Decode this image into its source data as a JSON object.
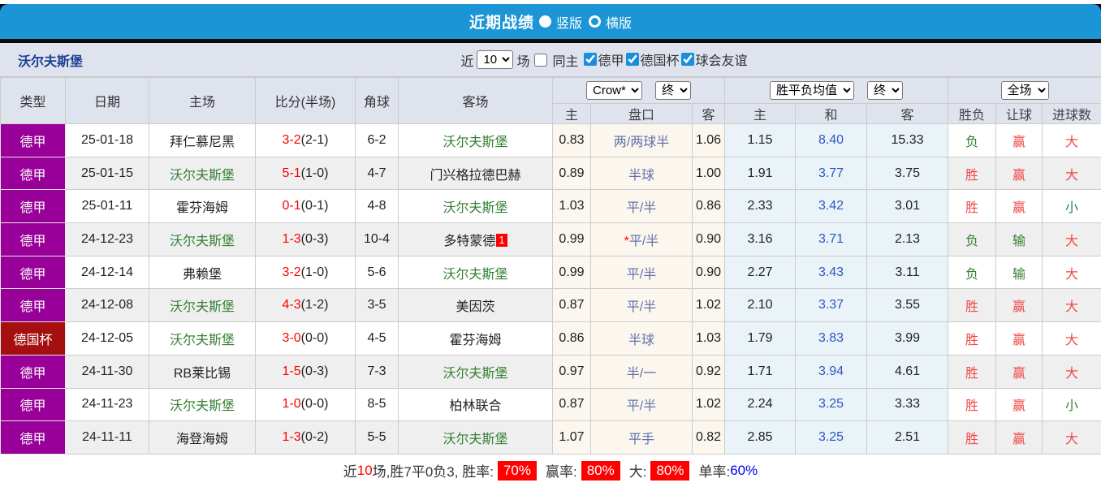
{
  "topbar": {
    "title": "近期战绩",
    "radio_vertical": "竖版",
    "radio_horizontal": "横版"
  },
  "filter": {
    "team": "沃尔夫斯堡",
    "near_label": "近",
    "count": "10",
    "unit_label": "场",
    "same_home_label": "同主",
    "comps": [
      {
        "label": "德甲",
        "checked": true
      },
      {
        "label": "德国杯",
        "checked": true
      },
      {
        "label": "球会友谊",
        "checked": true
      }
    ]
  },
  "table": {
    "main_headers": [
      "类型",
      "日期",
      "主场",
      "比分(半场)",
      "角球",
      "客场"
    ],
    "selects": {
      "bookmaker": "Crow*",
      "bookmaker_time": "终",
      "avg": "胜平负均值",
      "avg_time": "终",
      "scope": "全场"
    },
    "sub_headers": [
      "主",
      "盘口",
      "客",
      "主",
      "和",
      "客",
      "胜负",
      "让球",
      "进球数"
    ],
    "rows": [
      {
        "type": "德甲",
        "type_style": "league",
        "date": "25-01-18",
        "home": "拜仁慕尼黑",
        "home_is_focus": false,
        "score": "3-2",
        "half": "(2-1)",
        "corners": "6-2",
        "away": "沃尔夫斯堡",
        "away_is_focus": true,
        "away_badge": "",
        "odds_home": "0.83",
        "handicap_star": "",
        "handicap": "两/两球半",
        "odds_away": "1.06",
        "avg_home": "1.15",
        "avg_draw": "8.40",
        "avg_away": "15.33",
        "result": "负",
        "handicap_result": "赢",
        "goals": "大"
      },
      {
        "type": "德甲",
        "type_style": "league",
        "date": "25-01-15",
        "home": "沃尔夫斯堡",
        "home_is_focus": true,
        "score": "5-1",
        "half": "(1-0)",
        "corners": "4-7",
        "away": "门兴格拉德巴赫",
        "away_is_focus": false,
        "away_badge": "",
        "odds_home": "0.89",
        "handicap_star": "",
        "handicap": "半球",
        "odds_away": "1.00",
        "avg_home": "1.91",
        "avg_draw": "3.77",
        "avg_away": "3.75",
        "result": "胜",
        "handicap_result": "赢",
        "goals": "大"
      },
      {
        "type": "德甲",
        "type_style": "league",
        "date": "25-01-11",
        "home": "霍芬海姆",
        "home_is_focus": false,
        "score": "0-1",
        "half": "(0-1)",
        "corners": "4-8",
        "away": "沃尔夫斯堡",
        "away_is_focus": true,
        "away_badge": "",
        "odds_home": "1.03",
        "handicap_star": "",
        "handicap": "平/半",
        "odds_away": "0.86",
        "avg_home": "2.33",
        "avg_draw": "3.42",
        "avg_away": "3.01",
        "result": "胜",
        "handicap_result": "赢",
        "goals": "小"
      },
      {
        "type": "德甲",
        "type_style": "league",
        "date": "24-12-23",
        "home": "沃尔夫斯堡",
        "home_is_focus": true,
        "score": "1-3",
        "half": "(0-3)",
        "corners": "10-4",
        "away": "多特蒙德",
        "away_is_focus": false,
        "away_badge": "1",
        "odds_home": "0.99",
        "handicap_star": "*",
        "handicap": "平/半",
        "odds_away": "0.90",
        "avg_home": "3.16",
        "avg_draw": "3.71",
        "avg_away": "2.13",
        "result": "负",
        "handicap_result": "输",
        "goals": "大"
      },
      {
        "type": "德甲",
        "type_style": "league",
        "date": "24-12-14",
        "home": "弗赖堡",
        "home_is_focus": false,
        "score": "3-2",
        "half": "(1-0)",
        "corners": "5-6",
        "away": "沃尔夫斯堡",
        "away_is_focus": true,
        "away_badge": "",
        "odds_home": "0.99",
        "handicap_star": "",
        "handicap": "平/半",
        "odds_away": "0.90",
        "avg_home": "2.27",
        "avg_draw": "3.43",
        "avg_away": "3.11",
        "result": "负",
        "handicap_result": "输",
        "goals": "大"
      },
      {
        "type": "德甲",
        "type_style": "league",
        "date": "24-12-08",
        "home": "沃尔夫斯堡",
        "home_is_focus": true,
        "score": "4-3",
        "half": "(1-2)",
        "corners": "3-5",
        "away": "美因茨",
        "away_is_focus": false,
        "away_badge": "",
        "odds_home": "0.87",
        "handicap_star": "",
        "handicap": "平/半",
        "odds_away": "1.02",
        "avg_home": "2.10",
        "avg_draw": "3.37",
        "avg_away": "3.55",
        "result": "胜",
        "handicap_result": "赢",
        "goals": "大"
      },
      {
        "type": "德国杯",
        "type_style": "cup",
        "date": "24-12-05",
        "home": "沃尔夫斯堡",
        "home_is_focus": true,
        "score": "3-0",
        "half": "(0-0)",
        "corners": "4-5",
        "away": "霍芬海姆",
        "away_is_focus": false,
        "away_badge": "",
        "odds_home": "0.86",
        "handicap_star": "",
        "handicap": "半球",
        "odds_away": "1.03",
        "avg_home": "1.79",
        "avg_draw": "3.83",
        "avg_away": "3.99",
        "result": "胜",
        "handicap_result": "赢",
        "goals": "大"
      },
      {
        "type": "德甲",
        "type_style": "league",
        "date": "24-11-30",
        "home": "RB莱比锡",
        "home_is_focus": false,
        "score": "1-5",
        "half": "(0-3)",
        "corners": "7-3",
        "away": "沃尔夫斯堡",
        "away_is_focus": true,
        "away_badge": "",
        "odds_home": "0.97",
        "handicap_star": "",
        "handicap": "半/一",
        "odds_away": "0.92",
        "avg_home": "1.71",
        "avg_draw": "3.94",
        "avg_away": "4.61",
        "result": "胜",
        "handicap_result": "赢",
        "goals": "大"
      },
      {
        "type": "德甲",
        "type_style": "league",
        "date": "24-11-23",
        "home": "沃尔夫斯堡",
        "home_is_focus": true,
        "score": "1-0",
        "half": "(0-0)",
        "corners": "8-5",
        "away": "柏林联合",
        "away_is_focus": false,
        "away_badge": "",
        "odds_home": "0.87",
        "handicap_star": "",
        "handicap": "平/半",
        "odds_away": "1.02",
        "avg_home": "2.24",
        "avg_draw": "3.25",
        "avg_away": "3.33",
        "result": "胜",
        "handicap_result": "赢",
        "goals": "小"
      },
      {
        "type": "德甲",
        "type_style": "league",
        "date": "24-11-11",
        "home": "海登海姆",
        "home_is_focus": false,
        "score": "1-3",
        "half": "(0-2)",
        "corners": "5-5",
        "away": "沃尔夫斯堡",
        "away_is_focus": true,
        "away_badge": "",
        "odds_home": "1.07",
        "handicap_star": "",
        "handicap": "平手",
        "odds_away": "0.82",
        "avg_home": "2.85",
        "avg_draw": "3.25",
        "avg_away": "2.51",
        "result": "胜",
        "handicap_result": "赢",
        "goals": "大"
      }
    ]
  },
  "summary": {
    "near_label": "近",
    "near_count": "10",
    "tail": "场,胜7平0负3, 胜率:",
    "win_pct": "70%",
    "ying_label": "赢率:",
    "ying_pct": "80%",
    "big_label": "大:",
    "big_pct": "80%",
    "single_label": "单率:",
    "single_pct": "60%"
  },
  "colors": {
    "topbar_blue": "#1b95d5",
    "header_bg": "#dee3ed",
    "league_purple": "#990099",
    "cup_red": "#a50f0f",
    "score_red": "#ff0000",
    "focus_team_green": "#338033",
    "handicap_slate": "#6272aa",
    "odds_cream_bg": "#fbf6ee",
    "avg_blue_bg": "#eaf3f8",
    "avg_draw_blue": "#2b59c3",
    "result_red": "#f04848",
    "result_green": "#338033",
    "badge_red": "#ff0000",
    "single_rate_blue": "#0000ee"
  }
}
